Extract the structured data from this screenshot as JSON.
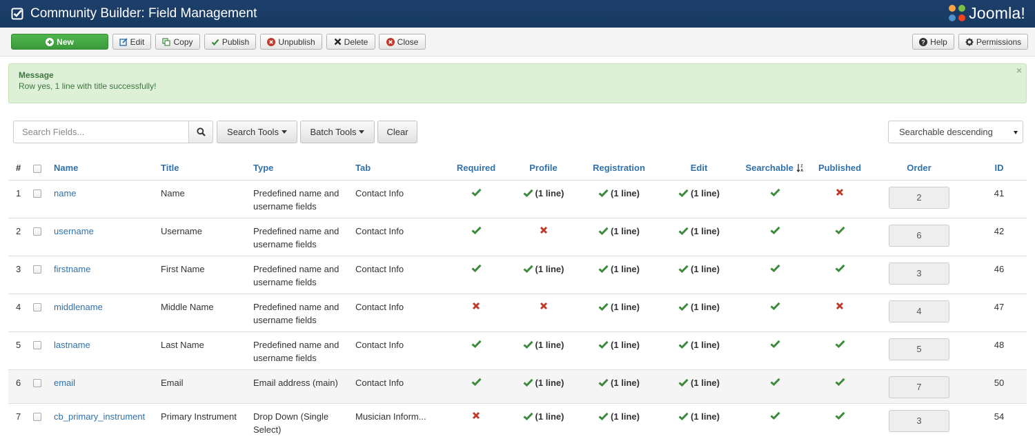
{
  "header": {
    "title": "Community Builder: Field Management",
    "logo_text": "Joomla!"
  },
  "toolbar": {
    "new_label": "New",
    "edit_label": "Edit",
    "copy_label": "Copy",
    "publish_label": "Publish",
    "unpublish_label": "Unpublish",
    "delete_label": "Delete",
    "close_label": "Close",
    "help_label": "Help",
    "permissions_label": "Permissions"
  },
  "message": {
    "heading": "Message",
    "text": "Row yes, 1 line with title successfully!",
    "close": "×"
  },
  "filters": {
    "search_placeholder": "Search Fields...",
    "search_tools_label": "Search Tools",
    "batch_tools_label": "Batch Tools",
    "clear_label": "Clear",
    "sort_value": "Searchable descending"
  },
  "table": {
    "columns": {
      "num": "#",
      "name": "Name",
      "title": "Title",
      "type": "Type",
      "tab": "Tab",
      "required": "Required",
      "profile": "Profile",
      "registration": "Registration",
      "edit": "Edit",
      "searchable": "Searchable",
      "published": "Published",
      "order": "Order",
      "id": "ID"
    },
    "one_line": "(1 line)",
    "rows": [
      {
        "num": "1",
        "name": "name",
        "title": "Name",
        "type_line1": "Predefined name and",
        "type_line2": "username fields",
        "tab": "Contact Info",
        "order": "2",
        "id": "41"
      },
      {
        "num": "2",
        "name": "username",
        "title": "Username",
        "type_line1": "Predefined name and",
        "type_line2": "username fields",
        "tab": "Contact Info",
        "order": "6",
        "id": "42"
      },
      {
        "num": "3",
        "name": "firstname",
        "title": "First Name",
        "type_line1": "Predefined name and",
        "type_line2": "username fields",
        "tab": "Contact Info",
        "order": "3",
        "id": "46"
      },
      {
        "num": "4",
        "name": "middlename",
        "title": "Middle Name",
        "type_line1": "Predefined name and",
        "type_line2": "username fields",
        "tab": "Contact Info",
        "order": "4",
        "id": "47"
      },
      {
        "num": "5",
        "name": "lastname",
        "title": "Last Name",
        "type_line1": "Predefined name and",
        "type_line2": "username fields",
        "tab": "Contact Info",
        "order": "5",
        "id": "48"
      },
      {
        "num": "6",
        "name": "email",
        "title": "Email",
        "type_line1": "Email address (main)",
        "type_line2": "",
        "tab": "Contact Info",
        "order": "7",
        "id": "50"
      },
      {
        "num": "7",
        "name": "cb_primary_instrument",
        "title": "Primary Instrument",
        "type_line1": "Drop Down (Single",
        "type_line2": "Select)",
        "tab": "Musician Inform...",
        "order": "3",
        "id": "54"
      }
    ]
  },
  "colors": {
    "check": "#3c8a3c",
    "cross": "#c0392b",
    "link": "#3071a9",
    "header_bg": "#1d3f6b"
  }
}
